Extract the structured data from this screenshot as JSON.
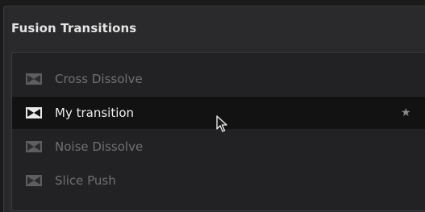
{
  "panel": {
    "title": "Fusion Transitions"
  },
  "transitions": [
    {
      "label": "Cross Dissolve",
      "icon": "transition-icon",
      "selected": false
    },
    {
      "label": "My transition",
      "icon": "transition-icon",
      "selected": true,
      "favorite_icon": "★"
    },
    {
      "label": "Noise Dissolve",
      "icon": "transition-icon",
      "selected": false
    },
    {
      "label": "Slice Push",
      "icon": "transition-icon",
      "selected": false
    }
  ],
  "colors": {
    "panel_bg": "#2a2a2c",
    "list_bg": "#222224",
    "selected_row_bg": "#121213",
    "dim_text": "#707072",
    "selected_text": "#ededed"
  }
}
